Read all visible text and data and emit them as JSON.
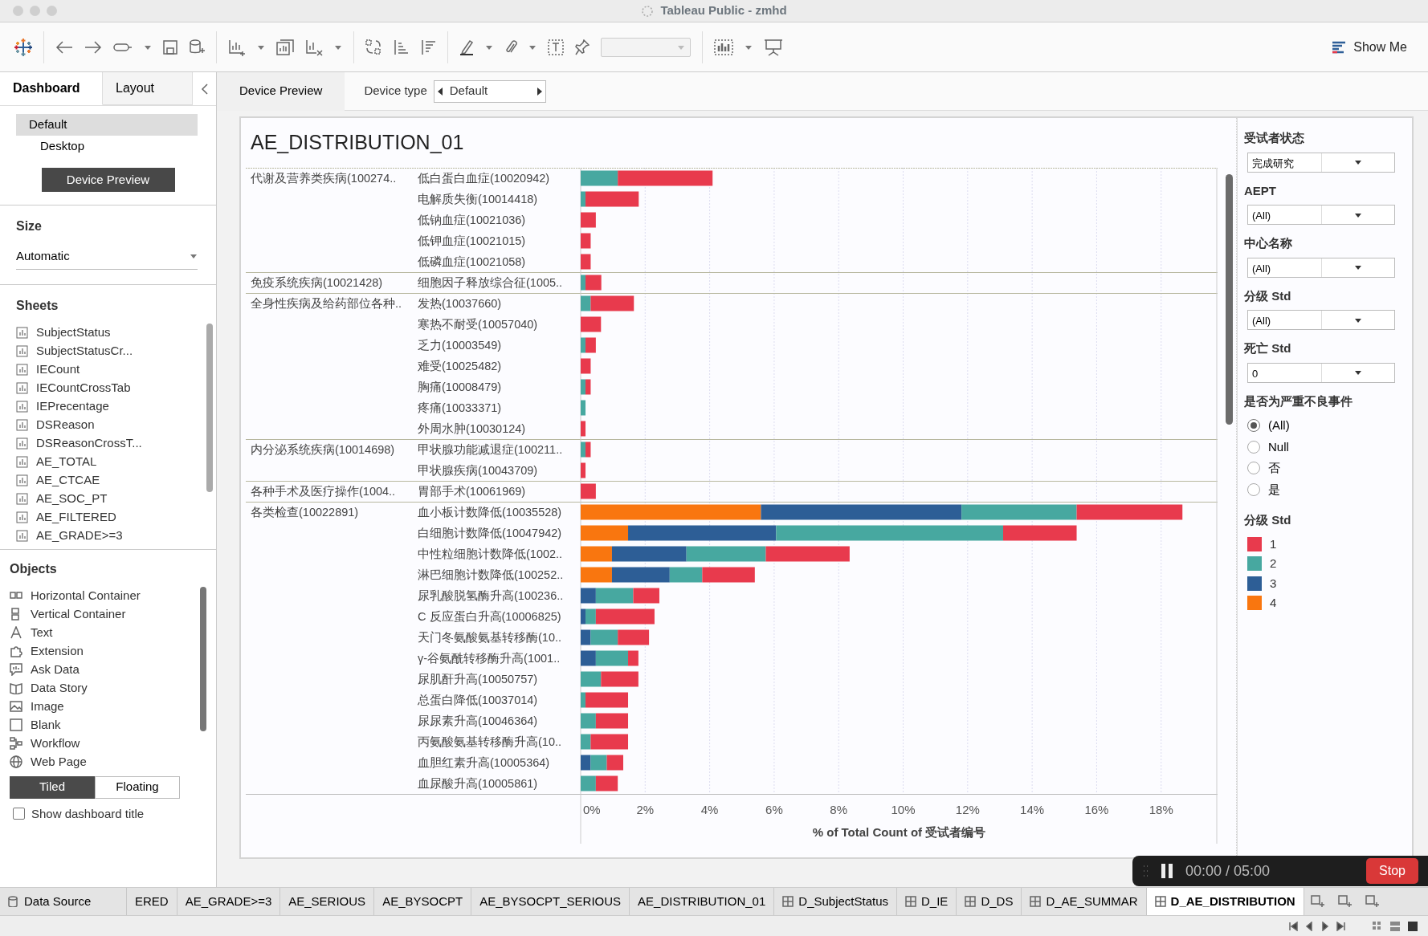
{
  "window": {
    "title": "Tableau Public - zmhd"
  },
  "toolbar": {
    "show_me": "Show Me"
  },
  "left_panel": {
    "tabs": [
      {
        "label": "Dashboard",
        "selected": true
      },
      {
        "label": "Layout",
        "selected": false
      }
    ],
    "devices": [
      {
        "label": "Default",
        "selected": true
      },
      {
        "label": "Desktop",
        "selected": false
      }
    ],
    "device_preview_button": "Device Preview",
    "size": {
      "title": "Size",
      "value": "Automatic"
    },
    "sheets": {
      "title": "Sheets",
      "items": [
        "SubjectStatus",
        "SubjectStatusCr...",
        "IECount",
        "IECountCrossTab",
        "IEPrecentage",
        "DSReason",
        "DSReasonCrossT...",
        "AE_TOTAL",
        "AE_CTCAE",
        "AE_SOC_PT",
        "AE_FILTERED",
        "AE_GRADE>=3"
      ]
    },
    "objects": {
      "title": "Objects",
      "items": [
        {
          "label": "Horizontal Container",
          "kind": "hcontainer"
        },
        {
          "label": "Vertical Container",
          "kind": "vcontainer"
        },
        {
          "label": "Text",
          "kind": "text"
        },
        {
          "label": "Extension",
          "kind": "extension"
        },
        {
          "label": "Ask Data",
          "kind": "askdata"
        },
        {
          "label": "Data Story",
          "kind": "story"
        },
        {
          "label": "Image",
          "kind": "image"
        },
        {
          "label": "Blank",
          "kind": "blank"
        },
        {
          "label": "Workflow",
          "kind": "workflow"
        },
        {
          "label": "Web Page",
          "kind": "web"
        }
      ]
    },
    "layout_mode": [
      {
        "label": "Tiled",
        "selected": true
      },
      {
        "label": "Floating",
        "selected": false
      }
    ],
    "show_title": {
      "label": "Show dashboard title",
      "checked": false
    }
  },
  "device_bar": {
    "tab": "Device Preview",
    "device_type_label": "Device type",
    "device_type_value": "Default"
  },
  "dashboard": {
    "title": "AE_DISTRIBUTION_01",
    "row_headers": [
      {
        "label": "代谢及营养类疾病(100274..",
        "children": [
          {
            "label": "低白蛋白血症(10020942)"
          },
          {
            "label": "电解质失衡(10014418)"
          },
          {
            "label": "低钠血症(10021036)"
          },
          {
            "label": "低钾血症(10021015)"
          },
          {
            "label": "低磷血症(10021058)"
          }
        ]
      },
      {
        "label": "免疫系统疾病(10021428)",
        "children": [
          {
            "label": "细胞因子释放综合征(1005.."
          }
        ]
      },
      {
        "label": "全身性疾病及给药部位各种..",
        "children": [
          {
            "label": "发热(10037660)"
          },
          {
            "label": "寒热不耐受(10057040)"
          },
          {
            "label": "乏力(10003549)"
          },
          {
            "label": "难受(10025482)"
          },
          {
            "label": "胸痛(10008479)"
          },
          {
            "label": "疼痛(10033371)"
          },
          {
            "label": "外周水肿(10030124)"
          }
        ]
      },
      {
        "label": "内分泌系统疾病(10014698)",
        "children": [
          {
            "label": "甲状腺功能减退症(100211.."
          },
          {
            "label": "甲状腺疾病(10043709)"
          }
        ]
      },
      {
        "label": "各种手术及医疗操作(1004..",
        "children": [
          {
            "label": "胃部手术(10061969)"
          }
        ]
      },
      {
        "label": "各类检查(10022891)",
        "children": [
          {
            "label": "血小板计数降低(10035528)"
          },
          {
            "label": "白细胞计数降低(10047942)"
          },
          {
            "label": "中性粒细胞计数降低(1002.."
          },
          {
            "label": "淋巴细胞计数降低(100252.."
          },
          {
            "label": "尿乳酸脱氢酶升高(100236.."
          },
          {
            "label": "C 反应蛋白升高(10006825)"
          },
          {
            "label": "天门冬氨酸氨基转移酶(10.."
          },
          {
            "label": "γ-谷氨酰转移酶升高(1001.."
          },
          {
            "label": "尿肌酐升高(10050757)"
          },
          {
            "label": "总蛋白降低(10037014)"
          },
          {
            "label": "尿尿素升高(10046364)"
          },
          {
            "label": "丙氨酸氨基转移酶升高(10.."
          },
          {
            "label": "血胆红素升高(10005364)"
          },
          {
            "label": "血尿酸升高(10005861)"
          }
        ]
      }
    ],
    "chart_data": {
      "type": "bar",
      "orientation": "horizontal",
      "stacked": true,
      "xlabel": "% of Total Count of 受试者编号",
      "grid": true,
      "series": [
        {
          "name": "4",
          "color": "#f9760f",
          "values": [
            null,
            null,
            null,
            null,
            null,
            null,
            null,
            null,
            null,
            null,
            null,
            null,
            null,
            null,
            null,
            null,
            5.59,
            1.47,
            0.97,
            0.97,
            null,
            null,
            null,
            null,
            null,
            null,
            null,
            null,
            null,
            null
          ]
        },
        {
          "name": "3",
          "color": "#2d5e96",
          "values": [
            null,
            null,
            null,
            null,
            null,
            null,
            null,
            null,
            null,
            null,
            null,
            null,
            null,
            null,
            null,
            null,
            6.22,
            4.59,
            2.31,
            1.79,
            0.47,
            0.15,
            0.31,
            0.47,
            null,
            null,
            null,
            null,
            0.31,
            null
          ]
        },
        {
          "name": "2",
          "color": "#47a8a0",
          "values": [
            1.15,
            0.15,
            null,
            null,
            null,
            0.15,
            0.31,
            null,
            0.15,
            null,
            0.15,
            0.15,
            null,
            0.15,
            null,
            null,
            3.57,
            7.04,
            2.46,
            1.01,
            1.16,
            0.32,
            0.84,
            1.0,
            0.63,
            0.15,
            0.47,
            0.31,
            0.5,
            0.47
          ]
        },
        {
          "name": "1",
          "color": "#e83a4d",
          "values": [
            2.94,
            1.65,
            0.47,
            0.31,
            0.31,
            0.49,
            1.34,
            0.63,
            0.32,
            0.31,
            0.16,
            null,
            0.15,
            0.16,
            0.15,
            0.47,
            3.28,
            2.28,
            2.6,
            1.63,
            0.81,
            1.82,
            0.97,
            0.32,
            1.16,
            1.32,
            1.0,
            1.16,
            0.51,
            0.68
          ]
        }
      ],
      "xlim": [
        0,
        19.75
      ],
      "xticks": [
        {
          "value": 0,
          "label": "0%"
        },
        {
          "value": 2,
          "label": "2%"
        },
        {
          "value": 4,
          "label": "4%"
        },
        {
          "value": 6,
          "label": "6%"
        },
        {
          "value": 8,
          "label": "8%"
        },
        {
          "value": 10,
          "label": "10%"
        },
        {
          "value": 12,
          "label": "12%"
        },
        {
          "value": 14,
          "label": "14%"
        },
        {
          "value": 16,
          "label": "16%"
        },
        {
          "value": 18,
          "label": "18%"
        }
      ]
    },
    "filters": [
      {
        "title": "受试者状态",
        "value": "完成研究"
      },
      {
        "title": "AEPT",
        "value": "(All)"
      },
      {
        "title": "中心名称",
        "value": "(All)"
      },
      {
        "title": "分级 Std",
        "value": "(All)"
      },
      {
        "title": "死亡 Std",
        "value": "0"
      }
    ],
    "radio_filter": {
      "title": "是否为严重不良事件",
      "options": [
        {
          "label": "(All)",
          "selected": true
        },
        {
          "label": "Null",
          "selected": false
        },
        {
          "label": "否",
          "selected": false
        },
        {
          "label": "是",
          "selected": false
        }
      ]
    },
    "legend": {
      "title": "分级 Std"
    }
  },
  "sheet_tabs": [
    {
      "label": "Data Source",
      "kind": "datasource",
      "selected": false
    },
    {
      "label": "ERED",
      "kind": "worksheet",
      "selected": false
    },
    {
      "label": "AE_GRADE>=3",
      "kind": "worksheet",
      "selected": false
    },
    {
      "label": "AE_SERIOUS",
      "kind": "worksheet",
      "selected": false
    },
    {
      "label": "AE_BYSOCPT",
      "kind": "worksheet",
      "selected": false
    },
    {
      "label": "AE_BYSOCPT_SERIOUS",
      "kind": "worksheet",
      "selected": false
    },
    {
      "label": "AE_DISTRIBUTION_01",
      "kind": "worksheet",
      "selected": false
    },
    {
      "label": "D_SubjectStatus",
      "kind": "dashboard",
      "selected": false
    },
    {
      "label": "D_IE",
      "kind": "dashboard",
      "selected": false
    },
    {
      "label": "D_DS",
      "kind": "dashboard",
      "selected": false
    },
    {
      "label": "D_AE_SUMMAR",
      "kind": "dashboard",
      "selected": false
    },
    {
      "label": "D_AE_DISTRIBUTION",
      "kind": "dashboard",
      "selected": true
    }
  ],
  "recording": {
    "time": "00:00 / 05:00",
    "stop": "Stop"
  }
}
